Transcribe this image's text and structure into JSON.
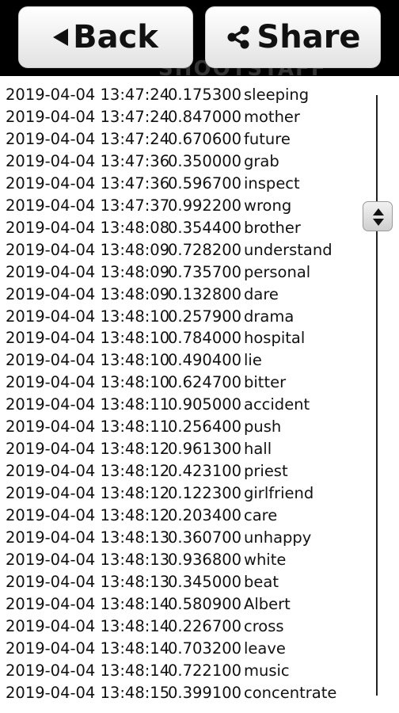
{
  "toolbar": {
    "back_label": "Back",
    "share_label": "Share",
    "watermark": "SHOOTSTAFF"
  },
  "icons": {
    "back": "back-arrow-icon",
    "share": "share-icon",
    "scroll": "scroll-thumb-icon"
  },
  "colors": {
    "toolbar_bg": "#000000",
    "button_bg": "#f0f0f0",
    "text": "#111111"
  },
  "log": [
    {
      "ts": "2019-04-04 13:47:24",
      "val": "0.175300",
      "word": "sleeping"
    },
    {
      "ts": "2019-04-04 13:47:24",
      "val": "0.847000",
      "word": "mother"
    },
    {
      "ts": "2019-04-04 13:47:24",
      "val": "0.670600",
      "word": "future"
    },
    {
      "ts": "2019-04-04 13:47:36",
      "val": "0.350000",
      "word": "grab"
    },
    {
      "ts": "2019-04-04 13:47:36",
      "val": "0.596700",
      "word": "inspect"
    },
    {
      "ts": "2019-04-04 13:47:37",
      "val": "0.992200",
      "word": "wrong"
    },
    {
      "ts": "2019-04-04 13:48:08",
      "val": "0.354400",
      "word": "brother"
    },
    {
      "ts": "2019-04-04 13:48:09",
      "val": "0.728200",
      "word": "understand"
    },
    {
      "ts": "2019-04-04 13:48:09",
      "val": "0.735700",
      "word": "personal"
    },
    {
      "ts": "2019-04-04 13:48:09",
      "val": "0.132800",
      "word": "dare"
    },
    {
      "ts": "2019-04-04 13:48:10",
      "val": "0.257900",
      "word": "drama"
    },
    {
      "ts": "2019-04-04 13:48:10",
      "val": "0.784000",
      "word": "hospital"
    },
    {
      "ts": "2019-04-04 13:48:10",
      "val": "0.490400",
      "word": "lie"
    },
    {
      "ts": "2019-04-04 13:48:10",
      "val": "0.624700",
      "word": "bitter"
    },
    {
      "ts": "2019-04-04 13:48:11",
      "val": "0.905000",
      "word": "accident"
    },
    {
      "ts": "2019-04-04 13:48:11",
      "val": "0.256400",
      "word": "push"
    },
    {
      "ts": "2019-04-04 13:48:12",
      "val": "0.961300",
      "word": "hall"
    },
    {
      "ts": "2019-04-04 13:48:12",
      "val": "0.423100",
      "word": "priest"
    },
    {
      "ts": "2019-04-04 13:48:12",
      "val": "0.122300",
      "word": "girlfriend"
    },
    {
      "ts": "2019-04-04 13:48:12",
      "val": "0.203400",
      "word": "care"
    },
    {
      "ts": "2019-04-04 13:48:13",
      "val": "0.360700",
      "word": "unhappy"
    },
    {
      "ts": "2019-04-04 13:48:13",
      "val": "0.936800",
      "word": "white"
    },
    {
      "ts": "2019-04-04 13:48:13",
      "val": "0.345000",
      "word": "beat"
    },
    {
      "ts": "2019-04-04 13:48:14",
      "val": "0.580900",
      "word": "Albert"
    },
    {
      "ts": "2019-04-04 13:48:14",
      "val": "0.226700",
      "word": "cross"
    },
    {
      "ts": "2019-04-04 13:48:14",
      "val": "0.703200",
      "word": "leave"
    },
    {
      "ts": "2019-04-04 13:48:14",
      "val": "0.722100",
      "word": "music"
    },
    {
      "ts": "2019-04-04 13:48:15",
      "val": "0.399100",
      "word": "concentrate"
    }
  ]
}
